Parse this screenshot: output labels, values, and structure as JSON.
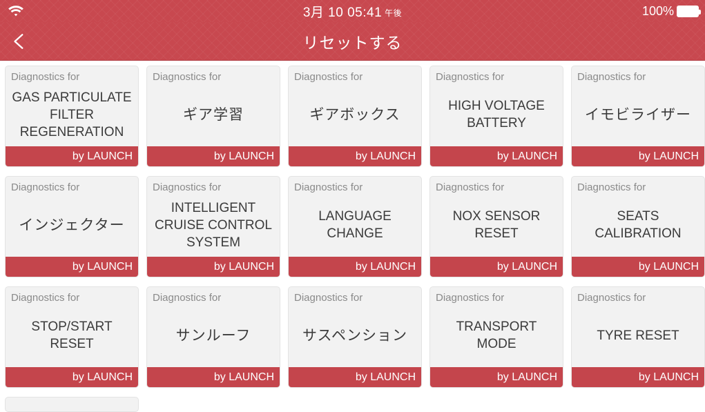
{
  "status_bar": {
    "wifi_icon": "wifi-icon",
    "datetime": "3月 10 05:41",
    "ampm": "午後",
    "battery_percent": "100%",
    "battery_icon": "battery-full-icon"
  },
  "title_bar": {
    "back_icon": "chevron-left-icon",
    "title": "リセットする"
  },
  "theme": {
    "header_red": "#c8484f",
    "footer_red": "#c4454c",
    "card_bg": "#f2f2f2",
    "page_bg": "#ffffff",
    "sub_text": "#8a8a8a",
    "title_text": "#3b3b3b"
  },
  "grid": {
    "subtitle_label": "Diagnostics for",
    "vendor_label": "by LAUNCH",
    "rows": [
      [
        {
          "subtitle": "Diagnostics for",
          "title": "GAS PARTICULATE FILTER REGENERATION",
          "vendor": "by LAUNCH",
          "jp": false
        },
        {
          "subtitle": "Diagnostics for",
          "title": "ギア学習",
          "vendor": "by LAUNCH",
          "jp": true
        },
        {
          "subtitle": "Diagnostics for",
          "title": "ギアボックス",
          "vendor": "by LAUNCH",
          "jp": true
        },
        {
          "subtitle": "Diagnostics for",
          "title": "HIGH VOLTAGE BATTERY",
          "vendor": "by LAUNCH",
          "jp": false
        },
        {
          "subtitle": "Diagnostics for",
          "title": "イモビライザー",
          "vendor": "by LAUNCH",
          "jp": true
        }
      ],
      [
        {
          "subtitle": "Diagnostics for",
          "title": "インジェクター",
          "vendor": "by LAUNCH",
          "jp": true
        },
        {
          "subtitle": "Diagnostics for",
          "title": "INTELLIGENT CRUISE CONTROL SYSTEM",
          "vendor": "by LAUNCH",
          "jp": false
        },
        {
          "subtitle": "Diagnostics for",
          "title": "LANGUAGE CHANGE",
          "vendor": "by LAUNCH",
          "jp": false
        },
        {
          "subtitle": "Diagnostics for",
          "title": "NOX SENSOR RESET",
          "vendor": "by LAUNCH",
          "jp": false
        },
        {
          "subtitle": "Diagnostics for",
          "title": "SEATS CALIBRATION",
          "vendor": "by LAUNCH",
          "jp": false
        }
      ],
      [
        {
          "subtitle": "Diagnostics for",
          "title": "STOP/START RESET",
          "vendor": "by LAUNCH",
          "jp": false
        },
        {
          "subtitle": "Diagnostics for",
          "title": "サンルーフ",
          "vendor": "by LAUNCH",
          "jp": true
        },
        {
          "subtitle": "Diagnostics for",
          "title": "サスペンション",
          "vendor": "by LAUNCH",
          "jp": true
        },
        {
          "subtitle": "Diagnostics for",
          "title": "TRANSPORT MODE",
          "vendor": "by LAUNCH",
          "jp": false
        },
        {
          "subtitle": "Diagnostics for",
          "title": "TYRE RESET",
          "vendor": "by LAUNCH",
          "jp": false
        }
      ]
    ],
    "partial_row": [
      {
        "subtitle": "",
        "title": "",
        "vendor": "",
        "jp": false
      }
    ]
  }
}
